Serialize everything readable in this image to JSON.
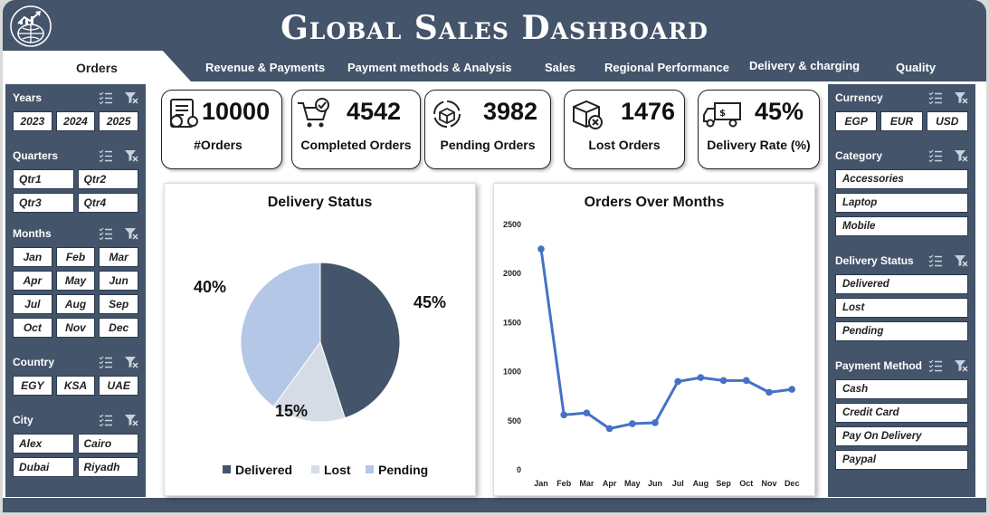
{
  "title": "Global Sales Dashboard",
  "tabs": [
    {
      "label": "Orders",
      "active": true
    },
    {
      "label": "Revenue & Payments"
    },
    {
      "label": "Payment methods & Analysis"
    },
    {
      "label": "Sales"
    },
    {
      "label": "Regional Performance"
    },
    {
      "label": "Delivery & charging"
    },
    {
      "label": "Quality"
    }
  ],
  "left_slicers": {
    "years": {
      "label": "Years",
      "items": [
        "2023",
        "2024",
        "2025"
      ]
    },
    "quarters": {
      "label": "Quarters",
      "items": [
        "Qtr1",
        "Qtr2",
        "Qtr3",
        "Qtr4"
      ]
    },
    "months": {
      "label": "Months",
      "items": [
        "Jan",
        "Feb",
        "Mar",
        "Apr",
        "May",
        "Jun",
        "Jul",
        "Aug",
        "Sep",
        "Oct",
        "Nov",
        "Dec"
      ]
    },
    "country": {
      "label": "Country",
      "items": [
        "EGY",
        "KSA",
        "UAE"
      ]
    },
    "city": {
      "label": "City",
      "items": [
        "Alex",
        "Cairo",
        "Dubai",
        "Riyadh"
      ]
    }
  },
  "right_slicers": {
    "currency": {
      "label": "Currency",
      "items": [
        "EGP",
        "EUR",
        "USD"
      ]
    },
    "category": {
      "label": "Category",
      "items": [
        "Accessories",
        "Laptop",
        "Mobile"
      ]
    },
    "delivery_status": {
      "label": "Delivery Status",
      "items": [
        "Delivered",
        "Lost",
        "Pending"
      ]
    },
    "payment_method": {
      "label": "Payment Method",
      "items": [
        "Cash",
        "Credit Card",
        "Pay On Delivery",
        "Paypal"
      ]
    }
  },
  "kpis": {
    "orders": {
      "value": "10000",
      "label": "#Orders"
    },
    "completed": {
      "value": "4542",
      "label": "Completed Orders"
    },
    "pending": {
      "value": "3982",
      "label": "Pending Orders"
    },
    "lost": {
      "value": "1476",
      "label": "Lost Orders"
    },
    "rate": {
      "value": "45%",
      "label": "Delivery Rate (%)"
    }
  },
  "colors": {
    "header": "#44546a",
    "delivered": "#44546a",
    "lost": "#d6dce5",
    "pending": "#b4c7e7",
    "line": "#4472c4"
  },
  "chart_data": [
    {
      "type": "pie",
      "title": "Delivery Status",
      "categories": [
        "Delivered",
        "Lost",
        "Pending"
      ],
      "values": [
        45,
        15,
        40
      ],
      "data_labels": [
        "45%",
        "15%",
        "40%"
      ],
      "legend": "bottom"
    },
    {
      "type": "line",
      "title": "Orders Over Months",
      "categories": [
        "Jan",
        "Feb",
        "Mar",
        "Apr",
        "May",
        "Jun",
        "Jul",
        "Aug",
        "Sep",
        "Oct",
        "Nov",
        "Dec"
      ],
      "values": [
        2250,
        560,
        580,
        420,
        470,
        480,
        900,
        940,
        910,
        910,
        790,
        820
      ],
      "ylim": [
        0,
        2500
      ],
      "yticks": [
        0,
        500,
        1000,
        1500,
        2000,
        2500
      ],
      "grid": false,
      "legend": "none"
    }
  ]
}
